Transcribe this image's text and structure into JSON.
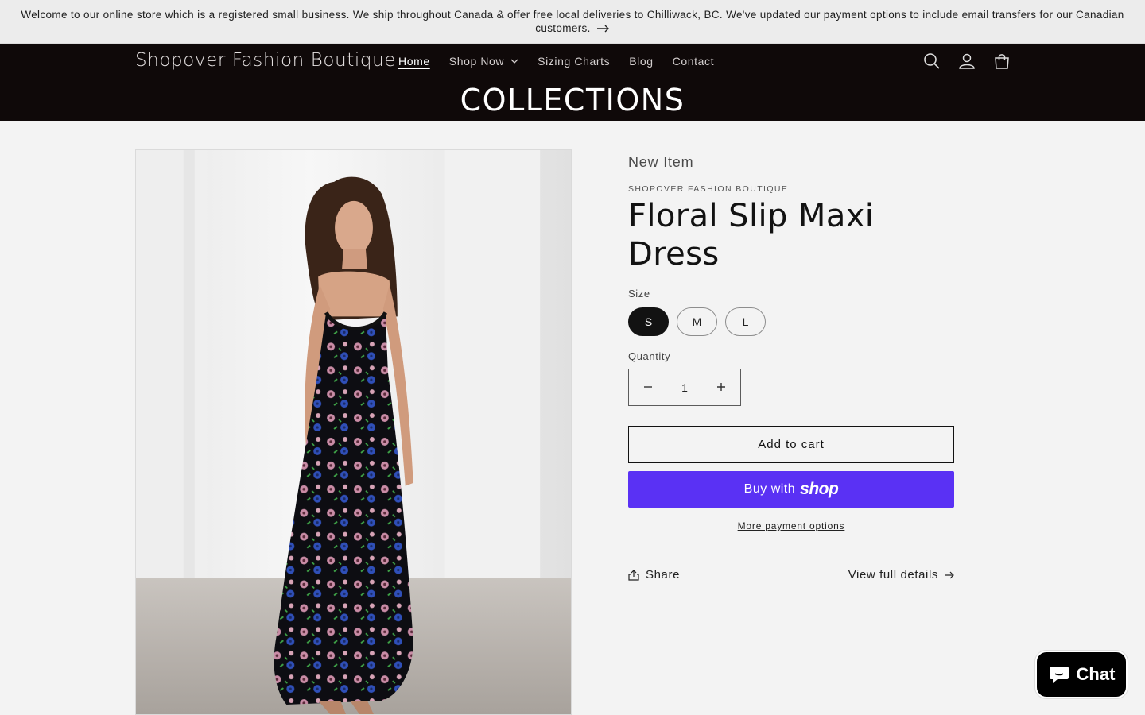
{
  "announcement": {
    "text": "Welcome to our online store which is a registered small business. We ship throughout Canada & offer free local deliveries to Chilliwack, BC. We've updated our payment options to include email transfers for our Canadian customers."
  },
  "header": {
    "logo": "Shopover Fashion Boutique",
    "nav": [
      {
        "label": "Home",
        "active": true
      },
      {
        "label": "Shop Now",
        "dropdown": true
      },
      {
        "label": "Sizing Charts"
      },
      {
        "label": "Blog"
      },
      {
        "label": "Contact"
      }
    ],
    "icons": [
      "search-icon",
      "account-icon",
      "cart-icon"
    ]
  },
  "banner": {
    "title": "COLLECTIONS"
  },
  "product": {
    "badge": "New Item",
    "vendor": "SHOPOVER FASHION BOUTIQUE",
    "title": "Floral Slip Maxi Dress",
    "size_label": "Size",
    "sizes": [
      "S",
      "M",
      "L"
    ],
    "selected_size": "S",
    "quantity_label": "Quantity",
    "quantity": "1",
    "add_to_cart": "Add to cart",
    "buy_with": "Buy with",
    "buy_brand": "shop",
    "more_payment": "More payment options",
    "share": "Share",
    "view_full": "View full details"
  },
  "chat": {
    "label": "Chat"
  },
  "colors": {
    "header_bg": "#0f0909",
    "shop_pay": "#5a31f4",
    "page_bg": "#f3f3f3"
  }
}
